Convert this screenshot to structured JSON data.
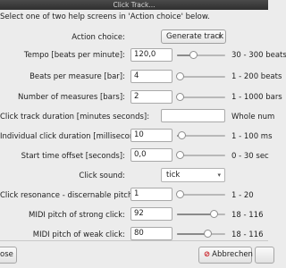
{
  "window": {
    "title": "Click Track..."
  },
  "intro": "Select one of two help screens in 'Action choice' below.",
  "action_choice": {
    "label": "Action choice:",
    "value": "Generate track"
  },
  "tempo": {
    "label": "Tempo [beats per minute]:",
    "value": "120,0",
    "range": "30 - 300 beats",
    "level": 0.33
  },
  "beats_per_measure": {
    "label": "Beats per measure [bar]:",
    "value": "4",
    "range": "1 - 200 beats",
    "level": 0.02
  },
  "measures": {
    "label": "Number of measures [bars]:",
    "value": "2",
    "range": "1 - 1000 bars",
    "level": 0.0
  },
  "track_duration": {
    "label": "Click track duration [minutes seconds]:",
    "value": "",
    "range": "Whole num"
  },
  "click_duration": {
    "label": "Individual click duration [milliseconds]:",
    "value": "10",
    "range": "1 - 100 ms",
    "level": 0.09
  },
  "start_offset": {
    "label": "Start time offset [seconds]:",
    "value": "0,0",
    "range": "0 - 30 sec",
    "level": 0.0
  },
  "click_sound": {
    "label": "Click sound:",
    "value": "tick"
  },
  "resonance": {
    "label": "Click resonance - discernable pitch [q]:",
    "value": "1",
    "range": "1 - 20",
    "level": 0.0
  },
  "pitch_strong": {
    "label": "MIDI pitch of strong click:",
    "value": "92",
    "range": "18 - 116",
    "level": 0.755
  },
  "pitch_weak": {
    "label": "MIDI pitch of weak click:",
    "value": "80",
    "range": "18 - 116",
    "level": 0.633
  },
  "buttons": {
    "close": "ose",
    "cancel": "Abbrechen",
    "cancel_icon": "cancel-circle-icon",
    "ok": ""
  }
}
